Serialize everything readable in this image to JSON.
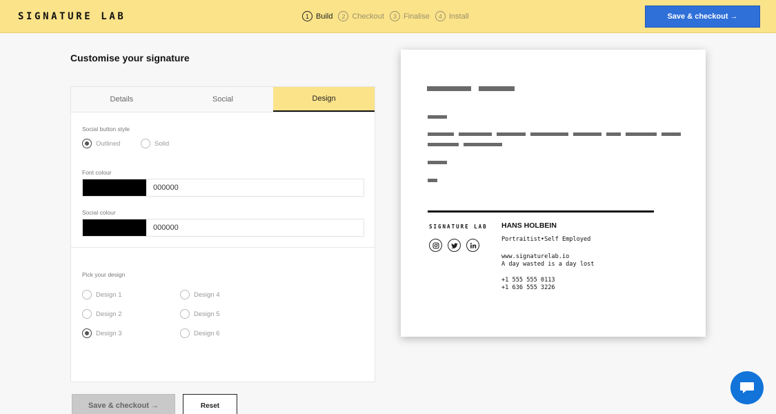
{
  "header": {
    "brand": "SIGNATURE LAB",
    "steps": [
      {
        "num": "1",
        "label": "Build"
      },
      {
        "num": "2",
        "label": "Checkout"
      },
      {
        "num": "3",
        "label": "Finalise"
      },
      {
        "num": "4",
        "label": "Install"
      }
    ],
    "cta_label": "Save & checkout →"
  },
  "editor": {
    "title": "Customise your signature",
    "tabs": [
      "Details",
      "Social",
      "Design"
    ],
    "social_button_style": {
      "label": "Social button style",
      "options": [
        "Outlined",
        "Solid"
      ],
      "selected": "Outlined"
    },
    "font_colour": {
      "label": "Font colour",
      "value": "000000",
      "swatch": "#000000"
    },
    "social_colour": {
      "label": "Social colour",
      "value": "000000",
      "swatch": "#000000"
    },
    "design": {
      "label": "Pick your design",
      "options": [
        "Design 1",
        "Design 2",
        "Design 3",
        "Design 4",
        "Design 5",
        "Design 6"
      ],
      "selected": "Design 3"
    },
    "save_label": "Save & checkout →",
    "reset_label": "Reset"
  },
  "preview": {
    "logo": "SIGNATURE LAB",
    "name": "HANS HOLBEIN",
    "title": "Portraitist•Self Employed",
    "website": "www.signaturelab.io",
    "tagline": "A day wasted is a day lost",
    "phone1": "+1 555 555 0113",
    "phone2": "+1 636 555 3226",
    "social_icons": [
      "instagram-icon",
      "twitter-icon",
      "linkedin-icon"
    ]
  },
  "colors": {
    "accent_yellow": "#fbe38a",
    "primary_blue": "#2f6fd8",
    "chat_blue": "#1273d9"
  }
}
